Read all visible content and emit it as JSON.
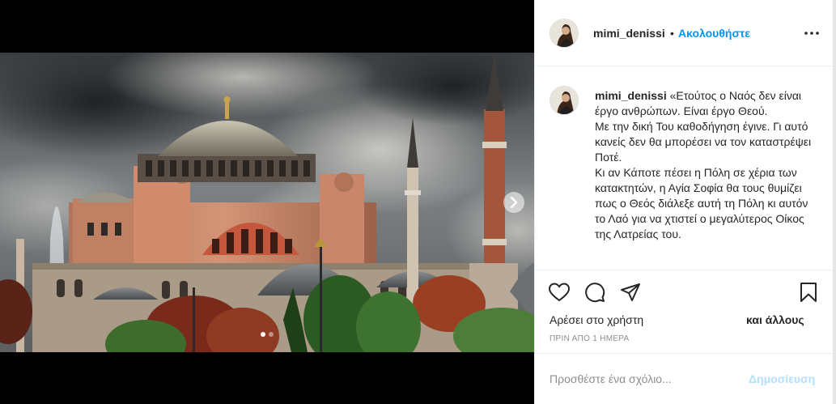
{
  "post": {
    "username": "mimi_denissi",
    "separator": "•",
    "follow_label": "Ακολουθήστε",
    "more_icon": "more-dots-icon",
    "caption_open": "«",
    "caption_text": "Ετούτος ο Ναός δεν είναι έργο ανθρώπων. Είναι έργο Θεού.\nΜε την δική Του καθοδήγηση έγινε. Γι αυτό κανείς δεν θα μπορέσει να τον καταστρέψει Ποτέ.\nΚι αν Κάποτε πέσει η Πόλη σε χέρια των κατακτητών, η Αγία Σοφία θα τους θυμίζει πως ο Θεός διάλεξε αυτή τη Πόλη κι αυτόν το Λαό για να χτιστεί ο μεγαλύτερος Οίκος της Λατρείας του.",
    "likes_prefix": "Αρέσει στο χρήστη",
    "likes_suffix": "και άλλους",
    "timestamp": "ΠΡΙΝ ΑΠΟ 1 ΗΜΕΡΑ"
  },
  "actions": {
    "like_icon": "heart-icon",
    "comment_icon": "comment-icon",
    "share_icon": "share-icon",
    "save_icon": "bookmark-icon"
  },
  "comment": {
    "placeholder": "Προσθέστε ένα σχόλιο...",
    "post_label": "Δημοσίευση"
  },
  "carousel": {
    "next_icon": "chevron-right-icon",
    "slide_count": 2,
    "active_index": 0
  },
  "colors": {
    "link_blue": "#0095f6",
    "disabled_blue": "#b2dffc",
    "border": "#efefef"
  }
}
